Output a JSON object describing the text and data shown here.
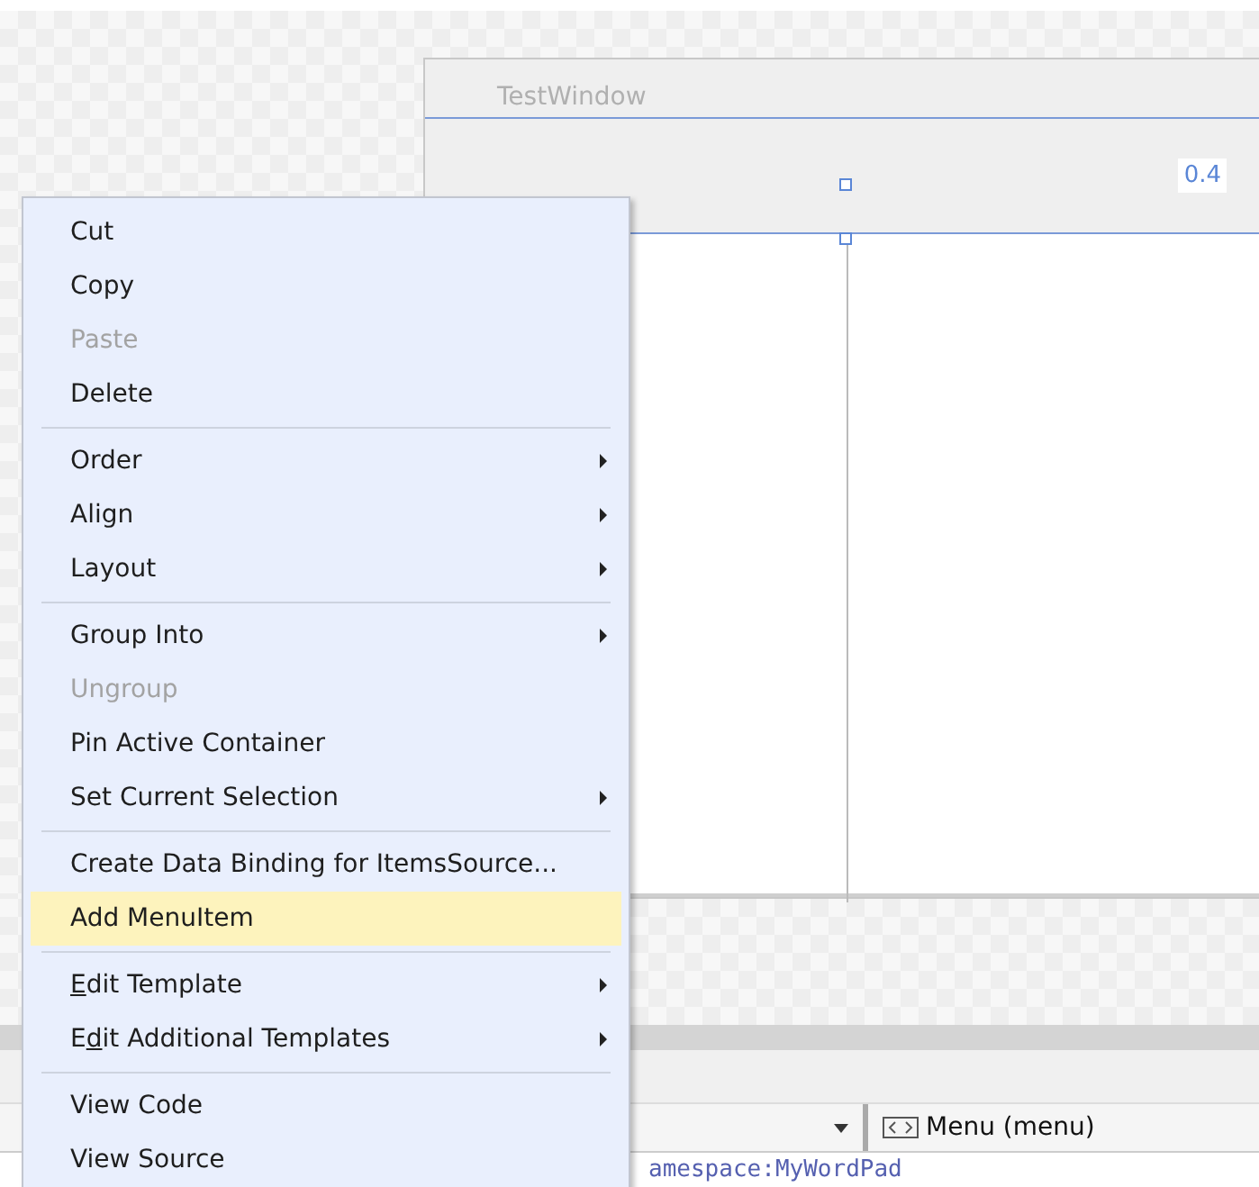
{
  "designer": {
    "window_title": "TestWindow",
    "ruler_value": "0.4"
  },
  "context_menu": {
    "items": [
      {
        "kind": "item",
        "label": "Cut",
        "disabled": false,
        "submenu": false,
        "selected": false
      },
      {
        "kind": "item",
        "label": "Copy",
        "disabled": false,
        "submenu": false,
        "selected": false
      },
      {
        "kind": "item",
        "label": "Paste",
        "disabled": true,
        "submenu": false,
        "selected": false
      },
      {
        "kind": "item",
        "label": "Delete",
        "disabled": false,
        "submenu": false,
        "selected": false
      },
      {
        "kind": "separator"
      },
      {
        "kind": "item",
        "label": "Order",
        "disabled": false,
        "submenu": true,
        "selected": false
      },
      {
        "kind": "item",
        "label": "Align",
        "disabled": false,
        "submenu": true,
        "selected": false
      },
      {
        "kind": "item",
        "label": "Layout",
        "disabled": false,
        "submenu": true,
        "selected": false
      },
      {
        "kind": "separator"
      },
      {
        "kind": "item",
        "label": "Group Into",
        "disabled": false,
        "submenu": true,
        "selected": false
      },
      {
        "kind": "item",
        "label": "Ungroup",
        "disabled": true,
        "submenu": false,
        "selected": false
      },
      {
        "kind": "item",
        "label": "Pin Active Container",
        "disabled": false,
        "submenu": false,
        "selected": false
      },
      {
        "kind": "item",
        "label": "Set Current Selection",
        "disabled": false,
        "submenu": true,
        "selected": false
      },
      {
        "kind": "separator"
      },
      {
        "kind": "item",
        "label": "Create Data Binding for ItemsSource...",
        "disabled": false,
        "submenu": false,
        "selected": false
      },
      {
        "kind": "item",
        "label": "Add MenuItem",
        "disabled": false,
        "submenu": false,
        "selected": true
      },
      {
        "kind": "separator"
      },
      {
        "kind": "item",
        "label_parts": [
          {
            "text": "E",
            "underline": true
          },
          {
            "text": "dit Template",
            "underline": false
          }
        ],
        "disabled": false,
        "submenu": true,
        "selected": false
      },
      {
        "kind": "item",
        "label_parts": [
          {
            "text": "E",
            "underline": false
          },
          {
            "text": "d",
            "underline": true
          },
          {
            "text": "it Additional Templates",
            "underline": false
          }
        ],
        "disabled": false,
        "submenu": true,
        "selected": false
      },
      {
        "kind": "separator"
      },
      {
        "kind": "item",
        "label": "View Code",
        "disabled": false,
        "submenu": false,
        "selected": false
      },
      {
        "kind": "item",
        "label": "View Source",
        "disabled": false,
        "submenu": false,
        "selected": false
      }
    ]
  },
  "navigation_bar": {
    "element_tag": "Menu (menu)"
  },
  "code_line": "amespace:MyWordPad"
}
